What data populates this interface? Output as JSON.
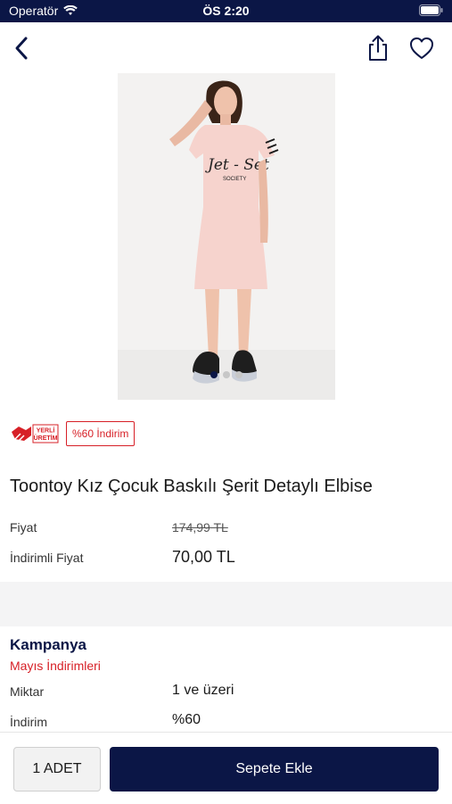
{
  "status_bar": {
    "carrier": "Operatör",
    "time": "ÖS 2:20"
  },
  "product": {
    "local_badge_line1": "YERLİ",
    "local_badge_line2": "ÜRETİM",
    "discount_badge": "%60 İndirim",
    "title": "Toontoy Kız Çocuk Baskılı Şerit Detaylı Elbise",
    "shirt_print_main": "Jet - Set",
    "shirt_print_sub": "SOCIETY",
    "price_label": "Fiyat",
    "old_price": "174,99 TL",
    "discounted_label": "İndirimli Fiyat",
    "discounted_price": "70,00 TL"
  },
  "campaign": {
    "heading": "Kampanya",
    "name": "Mayıs İndirimleri",
    "quantity_label": "Miktar",
    "quantity_value": "1 ve üzeri",
    "discount_label": "İndirim",
    "discount_value": "%60"
  },
  "bottom_bar": {
    "quantity_button": "1 ADET",
    "add_to_cart": "Sepete Ekle"
  },
  "icons": {
    "back": "chevron-left-icon",
    "share": "share-icon",
    "favorite": "heart-icon",
    "wifi": "wifi-icon",
    "battery": "battery-icon"
  },
  "colors": {
    "primary": "#0b1646",
    "accent_red": "#d72027",
    "dress_pink": "#f6d3cd"
  },
  "carousel": {
    "slide_count": 3,
    "active_index": 0
  }
}
